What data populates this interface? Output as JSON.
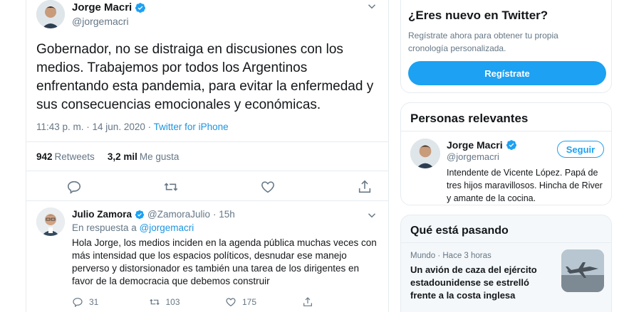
{
  "tweet": {
    "author_name": "Jorge Macri",
    "author_handle": "@jorgemacri",
    "text": "Gobernador, no se distraiga en discusiones con los medios. Trabajemos por todos los Argentinos enfrentando esta pandemia, para evitar la enfermedad y sus consecuencias emocionales y económicas.",
    "time": "11:43 p. m. · 14 jun. 2020 · ",
    "source": "Twitter for iPhone",
    "retweets_count": "942",
    "retweets_label": "Retweets",
    "likes_count": "3,2 mil",
    "likes_label": "Me gusta"
  },
  "reply": {
    "author_name": "Julio Zamora",
    "author_handle": "@ZamoraJulio",
    "time": "· 15h",
    "in_reply_prefix": "En respuesta a ",
    "in_reply_mention": "@jorgemacri",
    "text": "Hola Jorge, los medios inciden en la agenda pública muchas veces con más intensidad que los espacios políticos, desnudar ese manejo perverso y distorsionador es también una tarea de los dirigentes en favor de la democracia que debemos construir",
    "replies": "31",
    "retweets": "103",
    "likes": "175"
  },
  "signup_card": {
    "title": "¿Eres nuevo en Twitter?",
    "description": "Regístrate ahora para obtener tu propia cronología personalizada.",
    "button_label": "Regístrate"
  },
  "people_card": {
    "title": "Personas relevantes",
    "person_name": "Jorge Macri",
    "person_handle": "@jorgemacri",
    "follow_label": "Seguir",
    "bio": "Intendente de Vicente López. Papá de tres hijos maravillosos. Hincha de River y amante de la cocina."
  },
  "trends_card": {
    "title": "Qué está pasando",
    "trend_meta": "Mundo · Hace 3 horas",
    "trend_title": "Un avión de caza del ejército estadounidense se estrelló frente a la costa inglesa"
  },
  "colors": {
    "accent": "#1da1f2",
    "link": "#1b95e0",
    "muted": "#657786",
    "border": "#e6ecf0"
  },
  "icons": [
    "verified-badge-icon",
    "chevron-down-icon",
    "reply-icon",
    "retweet-icon",
    "like-icon",
    "share-icon"
  ]
}
